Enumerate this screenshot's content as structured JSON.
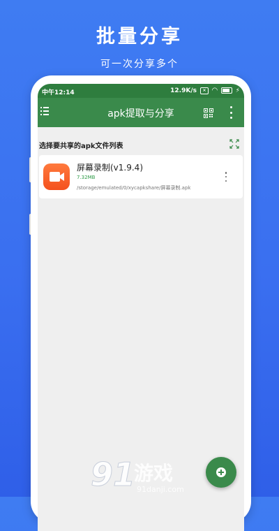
{
  "promo": {
    "title": "批量分享",
    "subtitle": "可一次分享多个"
  },
  "status_bar": {
    "time": "中午12:14",
    "network_speed": "12.9K/s",
    "sim_label": "×"
  },
  "app_bar": {
    "title": "apk提取与分享",
    "icons": [
      "menu-icon",
      "qr-code-icon",
      "more-vert-icon"
    ]
  },
  "section": {
    "title": "选择要共享的apk文件列表",
    "icon": "expand-icon"
  },
  "files": [
    {
      "name": "屏幕录制(v1.9.4)",
      "size": "7.32MB",
      "path": "/storage/emulated/0/xycapkshare/屏幕录制.apk",
      "icon": "video-camera-icon"
    }
  ],
  "fab": {
    "icon": "add-circle-icon"
  },
  "watermark": {
    "digits": "91",
    "text": "游戏",
    "url": "91danji.com"
  },
  "colors": {
    "background": "#3a6ff0",
    "app_green": "#3a8a4b",
    "status_green": "#2e7d3e",
    "app_icon_orange": "#f4511e",
    "size_green": "#2e9b47"
  }
}
